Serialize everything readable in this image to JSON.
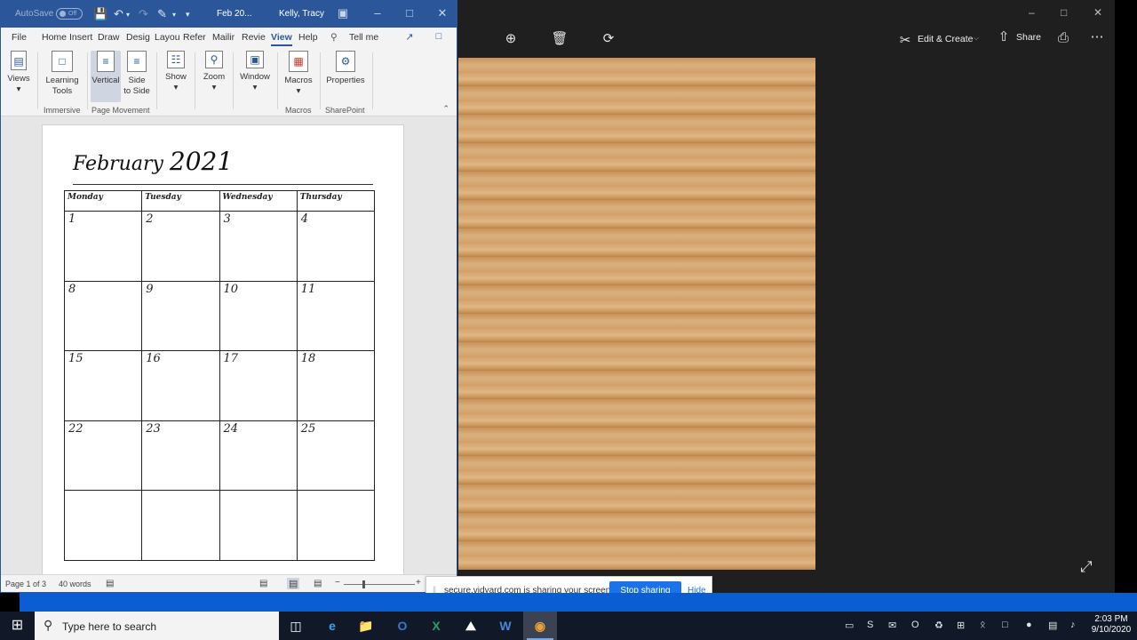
{
  "word": {
    "title": {
      "autosave": "AutoSave",
      "toggle": "Off",
      "document": "Feb 20...",
      "user": "Kelly, Tracy"
    },
    "tabs": [
      "File",
      "Home",
      "Insert",
      "Draw",
      "Desig",
      "Layou",
      "Refer",
      "Mailir",
      "Revie",
      "View",
      "Help"
    ],
    "active_tab": "View",
    "tell_me": "Tell me",
    "ribbon": {
      "views": "Views",
      "learning_tools_1": "Learning",
      "learning_tools_2": "Tools",
      "vertical": "Vertical",
      "side_1": "Side",
      "side_2": "to Side",
      "show": "Show",
      "zoom": "Zoom",
      "window": "Window",
      "macros": "Macros",
      "properties": "Properties",
      "group_immersive": "Immersive",
      "group_page_movement": "Page Movement",
      "group_macros": "Macros",
      "group_sharepoint": "SharePoint"
    },
    "calendar": {
      "month": "February",
      "year": "2021",
      "days": [
        "Monday",
        "Tuesday",
        "Wednesday",
        "Thursday"
      ],
      "rows": [
        [
          "1",
          "2",
          "3",
          "4"
        ],
        [
          "8",
          "9",
          "10",
          "11"
        ],
        [
          "15",
          "16",
          "17",
          "18"
        ],
        [
          "22",
          "23",
          "24",
          "25"
        ],
        [
          "",
          "",
          "",
          ""
        ]
      ]
    },
    "status": {
      "page": "Page 1 of 3",
      "words": "40 words"
    }
  },
  "photos": {
    "edit_create": "Edit & Create",
    "share": "Share"
  },
  "sharing": {
    "message": "secure.vidyard.com is sharing your screen.",
    "stop": "Stop sharing",
    "hide": "Hide"
  },
  "taskbar": {
    "search_placeholder": "Type here to search",
    "time": "2:03 PM",
    "date": "9/10/2020"
  }
}
